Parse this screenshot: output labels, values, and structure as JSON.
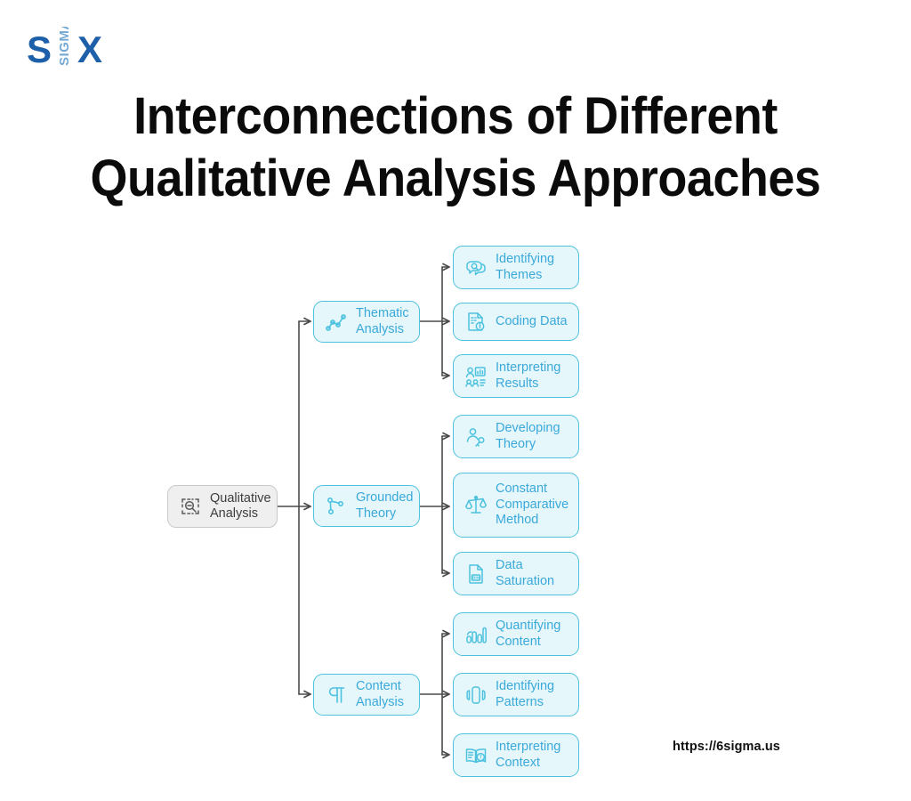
{
  "brand": {
    "logo_name": "six-sigma-logo",
    "logo_text_left": "S",
    "logo_text_right": "X",
    "logo_text_vertical": "SIGMA",
    "color_dark": "#1d5fa8",
    "color_light": "#74a9d6"
  },
  "title": {
    "line1": "Interconnections of Different",
    "line2": "Qualitative Analysis Approaches"
  },
  "footer": {
    "url": "https://6sigma.us"
  },
  "theme": {
    "node_border": "#4cc2de",
    "node_fill": "#e6f7fc",
    "node_text": "#3aa9da",
    "root_border": "#c9c9c9",
    "root_fill": "#efefef",
    "root_text": "#3d3d3d",
    "connector": "#4a4a4a"
  },
  "diagram": {
    "type": "tree",
    "root": {
      "label": "Qualitative\nAnalysis",
      "icon": "selection-zoom-out-icon"
    },
    "branches": [
      {
        "label": "Thematic\nAnalysis",
        "icon": "line-chart-nodes-icon",
        "children": [
          {
            "label": "Identifying\nThemes",
            "icon": "speech-bubbles-search-icon"
          },
          {
            "label": "Coding Data",
            "icon": "binary-document-info-icon"
          },
          {
            "label": "Interpreting\nResults",
            "icon": "person-presentation-chart-icon"
          }
        ]
      },
      {
        "label": "Grounded\nTheory",
        "icon": "node-branch-icon",
        "children": [
          {
            "label": "Developing\nTheory",
            "icon": "person-key-icon"
          },
          {
            "label": "Constant\nComparative\nMethod",
            "icon": "balance-scales-icon"
          },
          {
            "label": "Data\nSaturation",
            "icon": "bin-file-icon"
          }
        ]
      },
      {
        "label": "Content\nAnalysis",
        "icon": "pilcrow-icon",
        "children": [
          {
            "label": "Quantifying\nContent",
            "icon": "bar-chart-icon"
          },
          {
            "label": "Identifying\nPatterns",
            "icon": "pattern-shapes-icon"
          },
          {
            "label": "Interpreting\nContext",
            "icon": "open-book-search-icon"
          }
        ]
      }
    ]
  }
}
